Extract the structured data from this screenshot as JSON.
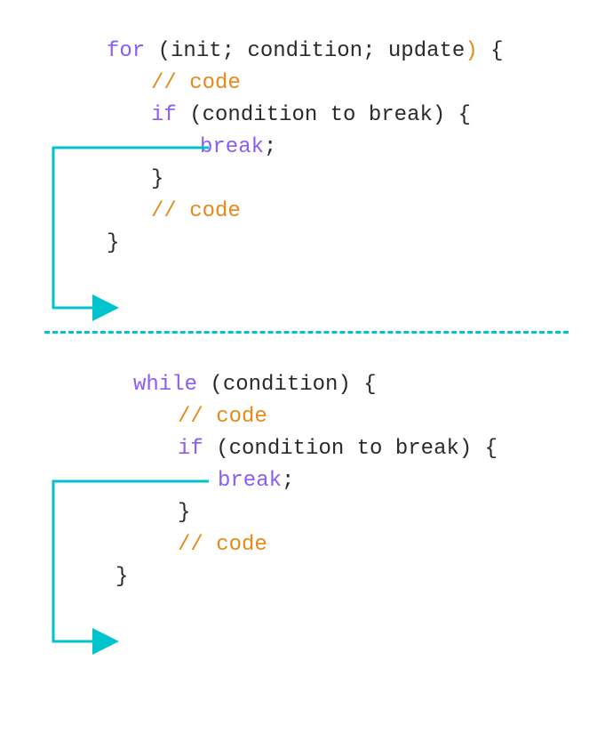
{
  "for_block": {
    "keyword": "for",
    "open_paren": " (",
    "init": "init",
    "sep1": "; ",
    "condition1": "condition",
    "sep2": "; ",
    "update": "update",
    "close_paren": ")",
    "open_brace": " {",
    "comment1": "// code",
    "if_keyword": "if",
    "if_open": " (",
    "if_cond": "condition to break",
    "if_close": ")",
    "if_brace": " {",
    "break_keyword": "break",
    "break_semi": ";",
    "if_close_brace": "}",
    "comment2": "// code",
    "close_brace": "}"
  },
  "while_block": {
    "keyword": "while",
    "open_paren": " (",
    "condition1": "condition",
    "close_paren": ")",
    "open_brace": " {",
    "comment1": "// code",
    "if_keyword": "if",
    "if_open": " (",
    "if_cond": "condition to break",
    "if_close": ")",
    "if_brace": " {",
    "break_keyword": "break",
    "break_semi": ";",
    "if_close_brace": "}",
    "comment2": "// code",
    "close_brace": "}"
  },
  "colors": {
    "keyword": "#8b5cf6",
    "orange": "#e28b1a",
    "arrow": "#00c4cc"
  }
}
